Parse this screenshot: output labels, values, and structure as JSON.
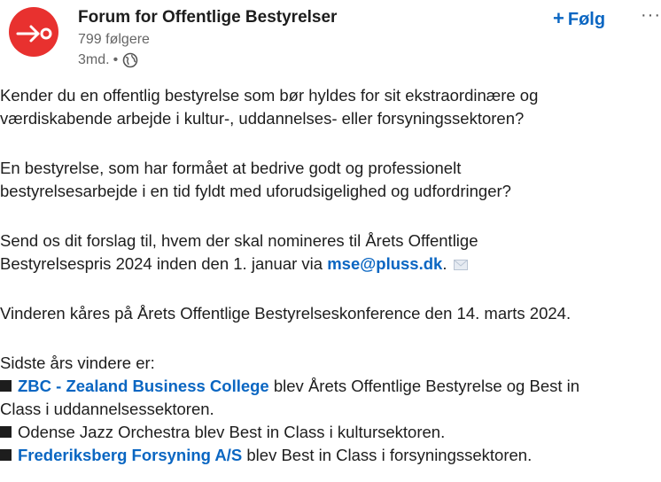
{
  "header": {
    "org_name": "Forum for Offentlige Bestyrelser",
    "followers": "799 følgere",
    "time": "3md.",
    "separator": "•",
    "follow_label": "Følg",
    "follow_plus": "+",
    "more": "···"
  },
  "colors": {
    "brand_red": "#e8312f",
    "link_blue": "#0a66c2"
  },
  "post": {
    "p1_line1": "Kender du en offentlig bestyrelse som bør hyldes for sit ekstraordinære og",
    "p1_line2": "værdiskabende arbejde i kultur-, uddannelses- eller forsyningssektoren?",
    "p2_line1": "En bestyrelse, som har formået at bedrive godt og professionelt",
    "p2_line2": "bestyrelsesarbejde i en tid fyldt med uforudsigelighed og udfordringer?",
    "p3_line1": "Send os dit forslag til, hvem der skal nomineres til Årets Offentlige",
    "p3_line2_prefix": "Bestyrelsespris 2024 inden den 1. januar via ",
    "p3_email": "mse@pluss.dk",
    "p3_line2_suffix": ".",
    "p4_line1": "Vinderen kåres på Årets Offentlige Bestyrelseskonference den 14. marts 2024.",
    "winners_intro": "Sidste års vindere er:",
    "winner1_link": "ZBC - Zealand Business College",
    "winner1_text": " blev Årets Offentlige Bestyrelse og Best in",
    "winner1_cont": "Class i uddannelsessektoren.",
    "winner2_text": "Odense Jazz Orchestra blev Best in Class i kultursektoren.",
    "winner3_link": "Frederiksberg Forsyning A/S",
    "winner3_text": " blev Best in Class i forsyningssektoren."
  }
}
